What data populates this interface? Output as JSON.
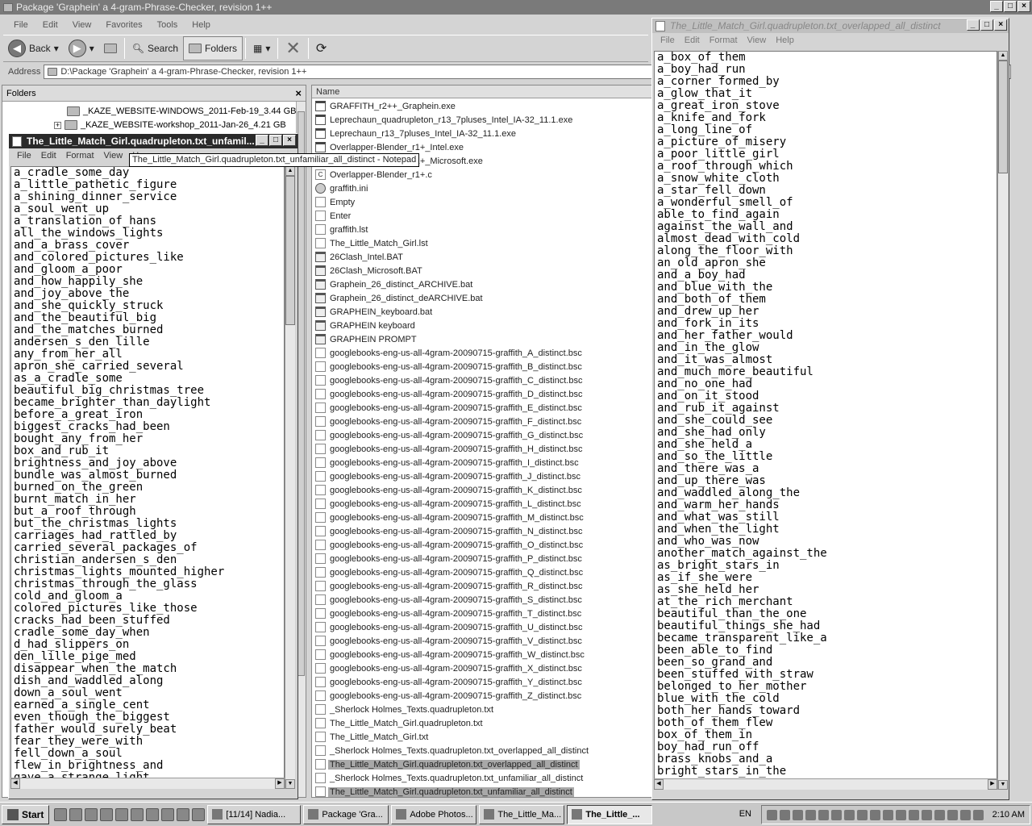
{
  "explorer": {
    "title": "Package 'Graphein' a 4-gram-Phrase-Checker, revision 1++",
    "menu": [
      "File",
      "Edit",
      "View",
      "Favorites",
      "Tools",
      "Help"
    ],
    "toolbar": {
      "back": "Back",
      "search": "Search",
      "folders": "Folders"
    },
    "address_label": "Address",
    "address_value": "D:\\Package 'Graphein' a 4-gram-Phrase-Checker, revision 1++",
    "folders_header": "Folders",
    "tree": [
      "_KAZE_WEBSITE-WINDOWS_2011-Feb-19_3.44 GB",
      "_KAZE_WEBSITE-workshop_2011-Jan-26_4.21 GB"
    ],
    "list_header": "Name",
    "files": [
      "GRAFFITH_r2++_Graphein.exe",
      "Leprechaun_quadrupleton_r13_7pluses_Intel_IA-32_11.1.exe",
      "Leprechaun_r13_7pluses_Intel_IA-32_11.1.exe",
      "Overlapper-Blender_r1+_Intel.exe",
      "Overlapper-Blender_r1+_Microsoft.exe",
      "Overlapper-Blender_r1+.c",
      "graffith.ini",
      "Empty",
      "Enter",
      "graffith.lst",
      "The_Little_Match_Girl.lst",
      "26Clash_Intel.BAT",
      "26Clash_Microsoft.BAT",
      "Graphein_26_distinct_ARCHIVE.bat",
      "Graphein_26_distinct_deARCHIVE.bat",
      "GRAPHEIN_keyboard.bat",
      "GRAPHEIN keyboard",
      "GRAPHEIN PROMPT",
      "googlebooks-eng-us-all-4gram-20090715-graffith_A_distinct.bsc",
      "googlebooks-eng-us-all-4gram-20090715-graffith_B_distinct.bsc",
      "googlebooks-eng-us-all-4gram-20090715-graffith_C_distinct.bsc",
      "googlebooks-eng-us-all-4gram-20090715-graffith_D_distinct.bsc",
      "googlebooks-eng-us-all-4gram-20090715-graffith_E_distinct.bsc",
      "googlebooks-eng-us-all-4gram-20090715-graffith_F_distinct.bsc",
      "googlebooks-eng-us-all-4gram-20090715-graffith_G_distinct.bsc",
      "googlebooks-eng-us-all-4gram-20090715-graffith_H_distinct.bsc",
      "googlebooks-eng-us-all-4gram-20090715-graffith_I_distinct.bsc",
      "googlebooks-eng-us-all-4gram-20090715-graffith_J_distinct.bsc",
      "googlebooks-eng-us-all-4gram-20090715-graffith_K_distinct.bsc",
      "googlebooks-eng-us-all-4gram-20090715-graffith_L_distinct.bsc",
      "googlebooks-eng-us-all-4gram-20090715-graffith_M_distinct.bsc",
      "googlebooks-eng-us-all-4gram-20090715-graffith_N_distinct.bsc",
      "googlebooks-eng-us-all-4gram-20090715-graffith_O_distinct.bsc",
      "googlebooks-eng-us-all-4gram-20090715-graffith_P_distinct.bsc",
      "googlebooks-eng-us-all-4gram-20090715-graffith_Q_distinct.bsc",
      "googlebooks-eng-us-all-4gram-20090715-graffith_R_distinct.bsc",
      "googlebooks-eng-us-all-4gram-20090715-graffith_S_distinct.bsc",
      "googlebooks-eng-us-all-4gram-20090715-graffith_T_distinct.bsc",
      "googlebooks-eng-us-all-4gram-20090715-graffith_U_distinct.bsc",
      "googlebooks-eng-us-all-4gram-20090715-graffith_V_distinct.bsc",
      "googlebooks-eng-us-all-4gram-20090715-graffith_W_distinct.bsc",
      "googlebooks-eng-us-all-4gram-20090715-graffith_X_distinct.bsc",
      "googlebooks-eng-us-all-4gram-20090715-graffith_Y_distinct.bsc",
      "googlebooks-eng-us-all-4gram-20090715-graffith_Z_distinct.bsc",
      "_Sherlock Holmes_Texts.quadrupleton.txt",
      "The_Little_Match_Girl.quadrupleton.txt",
      "The_Little_Match_Girl.txt",
      "_Sherlock Holmes_Texts.quadrupleton.txt_overlapped_all_distinct",
      "The_Little_Match_Girl.quadrupleton.txt_overlapped_all_distinct",
      "_Sherlock Holmes_Texts.quadrupleton.txt_unfamiliar_all_distinct",
      "The_Little_Match_Girl.quadrupleton.txt_unfamiliar_all_distinct"
    ],
    "selected_files": [
      48,
      50
    ]
  },
  "notepad_left": {
    "title": "The_Little_Match_Girl.quadrupleton.txt_unfamil...",
    "tooltip": "The_Little_Match_Girl.quadrupleton.txt_unfamiliar_all_distinct - Notepad",
    "menu": [
      "File",
      "Edit",
      "Format",
      "View",
      "H"
    ],
    "lines": [
      "a_cradle_some_day",
      "a_little_pathetic_figure",
      "a_shining_dinner_service",
      "a_soul_went_up",
      "a_translation_of_hans",
      "all_the_windows_lights",
      "and_a_brass_cover",
      "and_colored_pictures_like",
      "and_gloom_a_poor",
      "and_how_happily_she",
      "and_joy_above_the",
      "and_she_quickly_struck",
      "and_the_beautiful_big",
      "and_the_matches_burned",
      "andersen_s_den_lille",
      "any_from_her_all",
      "apron_she_carried_several",
      "as_a_cradle_some",
      "beautiful_big_christmas_tree",
      "became_brighter_than_daylight",
      "before_a_great_iron",
      "biggest_cracks_had_been",
      "bought_any_from_her",
      "box_and_rub_it",
      "brightness_and_joy_above",
      "bundle_was_almost_burned",
      "burned_on_the_green",
      "burnt_match_in_her",
      "but_a_roof_through",
      "but_the_christmas_lights",
      "carriages_had_rattled_by",
      "carried_several_packages_of",
      "christian_andersen_s_den",
      "christmas_lights_mounted_higher",
      "christmas_through_the_glass",
      "cold_and_gloom_a",
      "colored_pictures_like_those",
      "cracks_had_been_stuffed",
      "cradle_some_day_when",
      "d_had_slippers_on",
      "den_lille_pige_med",
      "disappear_when_the_match",
      "dish_and_waddled_along",
      "down_a_soul_went",
      "earned_a_single_cent",
      "even_though_the_biggest",
      "father_would_surely_beat",
      "fear_they_were_with",
      "fell_down_a_soul",
      "flew_in_brightness_and",
      "gave_a_strange_light"
    ]
  },
  "notepad_right": {
    "title": "The_Little_Match_Girl.quadrupleton.txt_overlapped_all_distinct",
    "menu": [
      "File",
      "Edit",
      "Format",
      "View",
      "Help"
    ],
    "lines": [
      "a_box_of_them",
      "a_boy_had_run",
      "a_corner_formed_by",
      "a_glow_that_it",
      "a_great_iron_stove",
      "a_knife_and_fork",
      "a_long_line_of",
      "a_picture_of_misery",
      "a_poor_little_girl",
      "a_roof_through_which",
      "a_snow_white_cloth",
      "a_star_fell_down",
      "a_wonderful_smell_of",
      "able_to_find_again",
      "against_the_wall_and",
      "almost_dead_with_cold",
      "along_the_floor_with",
      "an_old_apron_she",
      "and_a_boy_had",
      "and_blue_with_the",
      "and_both_of_them",
      "and_drew_up_her",
      "and_fork_in_its",
      "and_her_father_would",
      "and_in_the_glow",
      "and_it_was_almost",
      "and_much_more_beautiful",
      "and_no_one_had",
      "and_on_it_stood",
      "and_rub_it_against",
      "and_she_could_see",
      "and_she_had_only",
      "and_she_held_a",
      "and_so_the_little",
      "and_there_was_a",
      "and_up_there_was",
      "and_waddled_along_the",
      "and_warm_her_hands",
      "and_what_was_still",
      "and_when_the_light",
      "and_who_was_now",
      "another_match_against_the",
      "as_bright_stars_in",
      "as_if_she_were",
      "as_she_held_her",
      "at_the_rich_merchant",
      "beautiful_than_the_one",
      "beautiful_things_she_had",
      "became_transparent_like_a",
      "been_able_to_find",
      "been_so_grand_and",
      "been_stuffed_with_straw",
      "belonged_to_her_mother",
      "blue_with_the_cold",
      "both_her_hands_toward",
      "both_of_them_flew",
      "box_of_them_in",
      "boy_had_run_off",
      "brass_knobs_and_a",
      "bright_stars_in_the"
    ]
  },
  "taskbar": {
    "start": "Start",
    "tasks": [
      "[11/14] Nadia...",
      "Package 'Gra...",
      "Adobe Photos...",
      "The_Little_Ma...",
      "The_Little_..."
    ],
    "active_task": 4,
    "lang": "EN",
    "clock": "2:10 AM"
  }
}
